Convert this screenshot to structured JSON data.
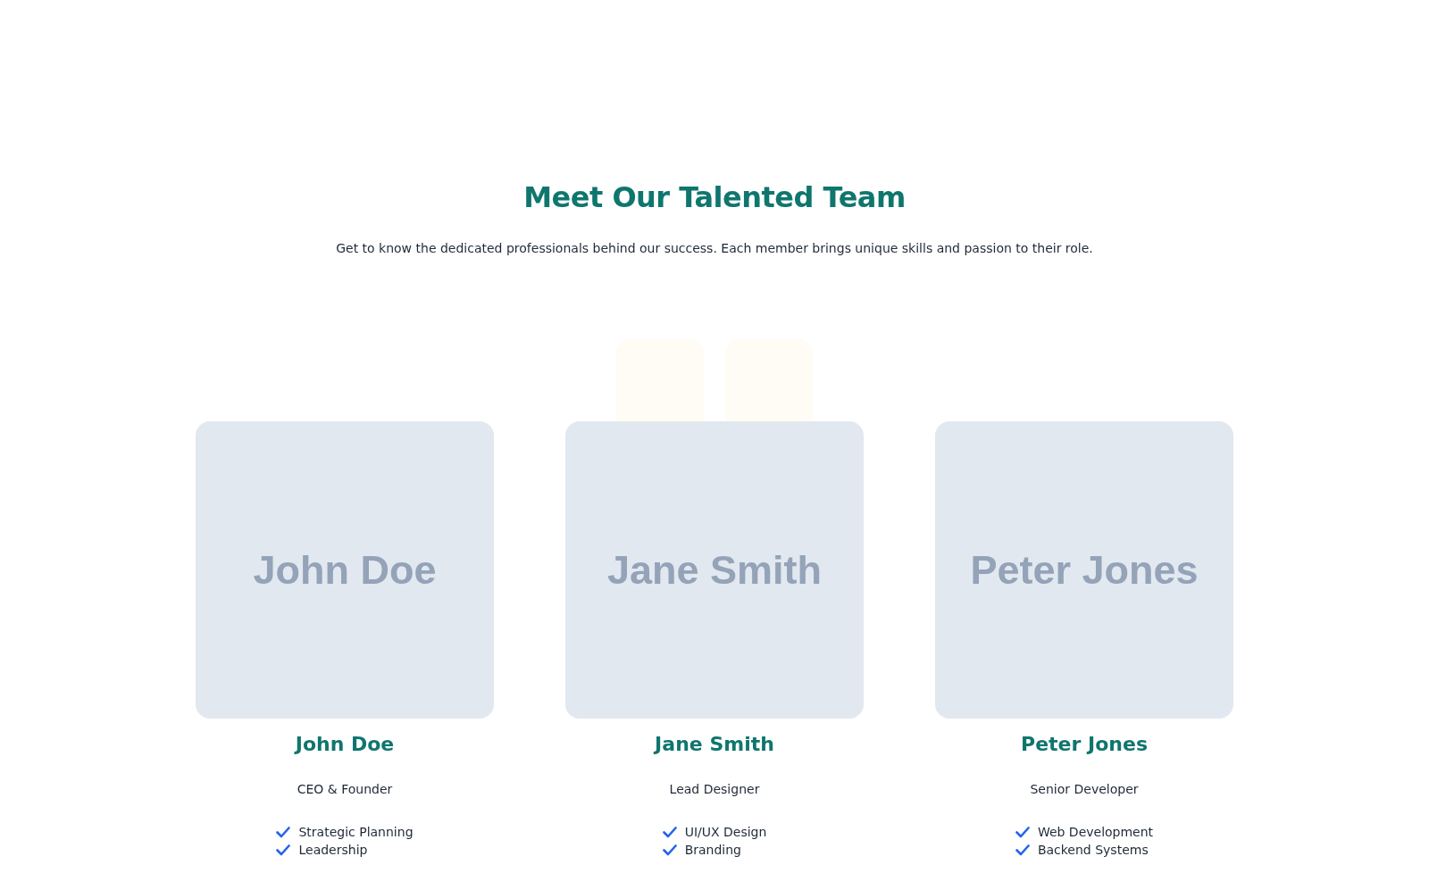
{
  "heading": "Meet Our Talented Team",
  "subtitle": "Get to know the dedicated professionals behind our success. Each member brings unique skills and passion to their role.",
  "decor_tiles": [
    {
      "kind": "tile"
    },
    {
      "kind": "tile"
    }
  ],
  "members": [
    {
      "photo_label": "John Doe",
      "name": "John Doe",
      "role": "CEO & Founder",
      "skills": [
        "Strategic Planning",
        "Leadership"
      ]
    },
    {
      "photo_label": "Jane Smith",
      "name": "Jane Smith",
      "role": "Lead Designer",
      "skills": [
        "UI/UX Design",
        "Branding"
      ]
    },
    {
      "photo_label": "Peter Jones",
      "name": "Peter Jones",
      "role": "Senior Developer",
      "skills": [
        "Web Development",
        "Backend Systems"
      ]
    }
  ]
}
